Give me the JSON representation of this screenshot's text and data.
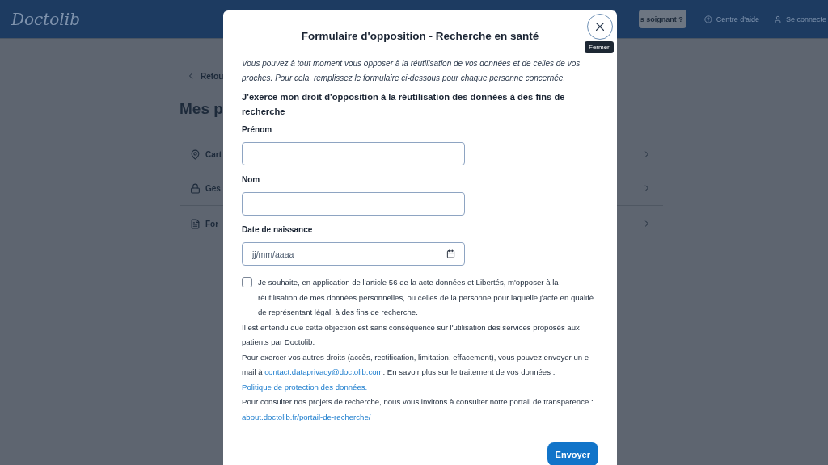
{
  "header": {
    "logo": "Doctolib",
    "pro_button": "s soignant ?",
    "links": [
      {
        "label": "Centre d'aide",
        "kind": "help"
      },
      {
        "label": "Se connecte",
        "kind": "user"
      }
    ]
  },
  "page": {
    "back_link": "Retou",
    "title": "Mes p",
    "rows": [
      {
        "label": "Cart",
        "kind": "pin"
      },
      {
        "label": "Ges",
        "kind": "lock"
      },
      {
        "label": "For",
        "kind": "document"
      }
    ]
  },
  "modal": {
    "title": "Formulaire d'opposition - Recherche en santé",
    "close_tooltip": "Fermer",
    "intro": "Vous pouvez à tout moment vous opposer à la réutilisation de vos données et de celles de vos proches. Pour cela, remplissez le formulaire ci-dessous pour chaque personne concernée.",
    "heading": "J'exerce mon droit d'opposition à la réutilisation des données à des fins de recherche",
    "fields": [
      {
        "label": "Prénom",
        "kind": "text"
      },
      {
        "label": "Nom",
        "kind": "text"
      },
      {
        "label": "Date de naissance",
        "kind": "date",
        "placeholder": "jj/mm/aaaa"
      }
    ],
    "consent": {
      "text": "Je souhaite, en application de l'article 56 de la acte données et Libertés, m'opposer à la réutilisation de mes données personnelles, ou celles de la personne pour laquelle j'acte en qualité de représentant légal, à des fins de recherche.",
      "checked": false
    },
    "paragraphs": [
      [
        {
          "text": "Il est entendu que cette objection est sans conséquence sur l'utilisation des services proposés aux patients par Doctolib."
        }
      ],
      [
        {
          "text": "Pour exercer vos autres droits (accès, rectification, limitation, effacement), vous pouvez envoyer un e-mail à "
        },
        {
          "link": "contact.dataprivacy@doctolib.com"
        },
        {
          "text": ". En savoir plus sur le traitement de vos données : "
        },
        {
          "link": "Politique de protection des données."
        }
      ],
      [
        {
          "text": "Pour consulter nos projets de recherche, nous vous invitons à consulter notre portail de transparence : "
        },
        {
          "link": "about.doctolib.fr/portail-de-recherche/"
        }
      ]
    ],
    "submit": "Envoyer"
  }
}
